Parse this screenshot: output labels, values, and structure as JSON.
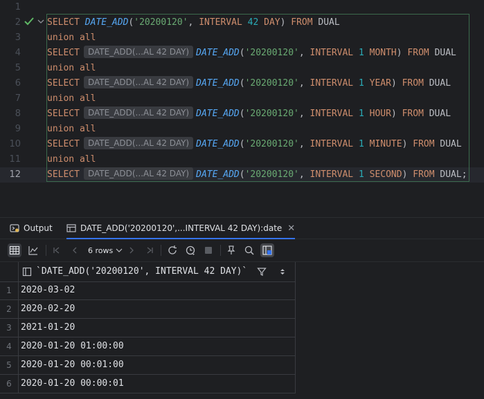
{
  "editor": {
    "line_numbers": [
      "1",
      "2",
      "3",
      "4",
      "5",
      "6",
      "7",
      "8",
      "9",
      "10",
      "11",
      "12"
    ],
    "lines": [
      {
        "tokens": []
      },
      {
        "tokens": [
          {
            "t": "SELECT ",
            "c": "kw"
          },
          {
            "t": "DATE_ADD",
            "c": "fn"
          },
          {
            "t": "(",
            "c": "pl"
          },
          {
            "t": "'20200120'",
            "c": "str"
          },
          {
            "t": ", ",
            "c": "pl"
          },
          {
            "t": "INTERVAL ",
            "c": "kw"
          },
          {
            "t": "42",
            "c": "num"
          },
          {
            "t": " DAY",
            "c": "kw"
          },
          {
            "t": ") ",
            "c": "pl"
          },
          {
            "t": "FROM ",
            "c": "kw"
          },
          {
            "t": "DUAL",
            "c": "pl"
          }
        ]
      },
      {
        "tokens": [
          {
            "t": "union all",
            "c": "kw"
          }
        ]
      },
      {
        "tokens": [
          {
            "t": "SELECT",
            "c": "kw"
          },
          {
            "t": "DATE_ADD(...AL 42 DAY)",
            "c": "hint"
          },
          {
            "t": "DATE_ADD",
            "c": "fn"
          },
          {
            "t": "(",
            "c": "pl"
          },
          {
            "t": "'20200120'",
            "c": "str"
          },
          {
            "t": ", ",
            "c": "pl"
          },
          {
            "t": "INTERVAL ",
            "c": "kw"
          },
          {
            "t": "1",
            "c": "num"
          },
          {
            "t": " MONTH",
            "c": "kw"
          },
          {
            "t": ") ",
            "c": "pl"
          },
          {
            "t": "FROM ",
            "c": "kw"
          },
          {
            "t": "DUAL",
            "c": "pl"
          }
        ]
      },
      {
        "tokens": [
          {
            "t": "union all",
            "c": "kw"
          }
        ]
      },
      {
        "tokens": [
          {
            "t": "SELECT",
            "c": "kw"
          },
          {
            "t": "DATE_ADD(...AL 42 DAY)",
            "c": "hint"
          },
          {
            "t": "DATE_ADD",
            "c": "fn"
          },
          {
            "t": "(",
            "c": "pl"
          },
          {
            "t": "'20200120'",
            "c": "str"
          },
          {
            "t": ", ",
            "c": "pl"
          },
          {
            "t": "INTERVAL ",
            "c": "kw"
          },
          {
            "t": "1",
            "c": "num"
          },
          {
            "t": " YEAR",
            "c": "kw"
          },
          {
            "t": ") ",
            "c": "pl"
          },
          {
            "t": "FROM ",
            "c": "kw"
          },
          {
            "t": "DUAL",
            "c": "pl"
          }
        ]
      },
      {
        "tokens": [
          {
            "t": "union all",
            "c": "kw"
          }
        ]
      },
      {
        "tokens": [
          {
            "t": "SELECT",
            "c": "kw"
          },
          {
            "t": "DATE_ADD(...AL 42 DAY)",
            "c": "hint"
          },
          {
            "t": "DATE_ADD",
            "c": "fn"
          },
          {
            "t": "(",
            "c": "pl"
          },
          {
            "t": "'20200120'",
            "c": "str"
          },
          {
            "t": ", ",
            "c": "pl"
          },
          {
            "t": "INTERVAL ",
            "c": "kw"
          },
          {
            "t": "1",
            "c": "num"
          },
          {
            "t": " HOUR",
            "c": "kw"
          },
          {
            "t": ") ",
            "c": "pl"
          },
          {
            "t": "FROM ",
            "c": "kw"
          },
          {
            "t": "DUAL",
            "c": "pl"
          }
        ]
      },
      {
        "tokens": [
          {
            "t": "union all",
            "c": "kw"
          }
        ]
      },
      {
        "tokens": [
          {
            "t": "SELECT",
            "c": "kw"
          },
          {
            "t": "DATE_ADD(...AL 42 DAY)",
            "c": "hint"
          },
          {
            "t": "DATE_ADD",
            "c": "fn"
          },
          {
            "t": "(",
            "c": "pl"
          },
          {
            "t": "'20200120'",
            "c": "str"
          },
          {
            "t": ", ",
            "c": "pl"
          },
          {
            "t": "INTERVAL ",
            "c": "kw"
          },
          {
            "t": "1",
            "c": "num"
          },
          {
            "t": " MINUTE",
            "c": "kw"
          },
          {
            "t": ") ",
            "c": "pl"
          },
          {
            "t": "FROM ",
            "c": "kw"
          },
          {
            "t": "DUAL",
            "c": "pl"
          }
        ]
      },
      {
        "tokens": [
          {
            "t": "union all",
            "c": "kw"
          }
        ]
      },
      {
        "tokens": [
          {
            "t": "SELECT",
            "c": "kw"
          },
          {
            "t": "DATE_ADD(...AL 42 DAY)",
            "c": "hint"
          },
          {
            "t": "DATE_ADD",
            "c": "fn"
          },
          {
            "t": "(",
            "c": "pl"
          },
          {
            "t": "'20200120'",
            "c": "str"
          },
          {
            "t": ", ",
            "c": "pl"
          },
          {
            "t": "INTERVAL ",
            "c": "kw"
          },
          {
            "t": "1",
            "c": "num"
          },
          {
            "t": " SECOND",
            "c": "kw"
          },
          {
            "t": ") ",
            "c": "pl"
          },
          {
            "t": "FROM ",
            "c": "kw"
          },
          {
            "t": "DUAL",
            "c": "pl"
          },
          {
            "t": ";",
            "c": "pl"
          }
        ]
      }
    ]
  },
  "tool_window": {
    "tabs": [
      {
        "label": "Output",
        "icon": "output-icon"
      },
      {
        "label": "DATE_ADD('20200120',...INTERVAL 42 DAY):date",
        "icon": "table-icon"
      }
    ],
    "rows_label": "6 rows",
    "toolbar_icons": [
      "table-view-icon",
      "chart-icon",
      "first-page-icon",
      "prev-page-icon",
      "rows-dropdown",
      "next-page-icon",
      "last-page-icon",
      "refresh-icon",
      "history-icon",
      "stop-icon",
      "pin-icon",
      "search-icon",
      "output-layout-icon"
    ]
  },
  "grid": {
    "column_header": "`DATE_ADD('20200120', INTERVAL 42 DAY)`",
    "rows": [
      {
        "num": "1",
        "value": "2020-03-02"
      },
      {
        "num": "2",
        "value": "2020-02-20"
      },
      {
        "num": "3",
        "value": "2021-01-20"
      },
      {
        "num": "4",
        "value": "2020-01-20 01:00:00"
      },
      {
        "num": "5",
        "value": "2020-01-20 00:01:00"
      },
      {
        "num": "6",
        "value": "2020-01-20 00:00:01"
      }
    ]
  },
  "colors": {
    "background": "#1e1f22",
    "keyword": "#cf8e6d",
    "function": "#56a8f5",
    "string": "#6aab73",
    "number": "#2aacb8",
    "accent": "#3574f0",
    "ok": "#5fb865"
  }
}
